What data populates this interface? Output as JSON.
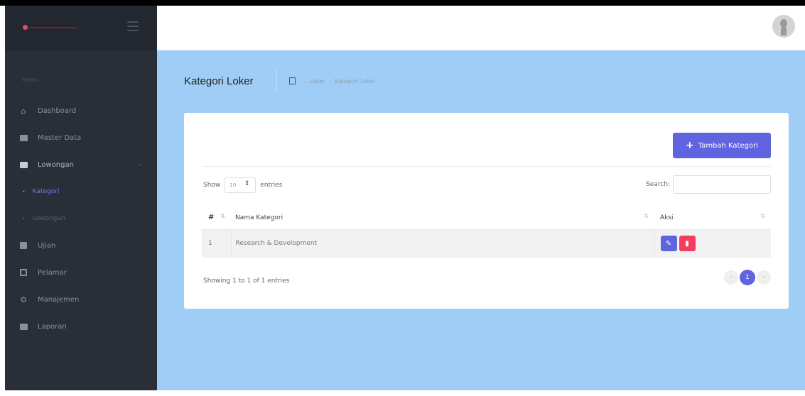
{
  "sidebar": {
    "menu_label": "MENU",
    "items": [
      {
        "label": "Dashboard",
        "icon": "dashboard-icon"
      },
      {
        "label": "Master Data",
        "icon": "folder-icon"
      },
      {
        "label": "Lowongan",
        "icon": "briefcase-icon"
      },
      {
        "label": "Ujian",
        "icon": "exam-icon"
      },
      {
        "label": "Pelamar",
        "icon": "applicant-icon"
      },
      {
        "label": "Manajemen",
        "icon": "gear-icon"
      },
      {
        "label": "Laporan",
        "icon": "folder-icon"
      }
    ],
    "subitems": [
      {
        "label": "Kategori"
      },
      {
        "label": "Lowongan"
      }
    ]
  },
  "page": {
    "title": "Kategori Loker",
    "breadcrumb": [
      "Loker",
      "Kategori Loker"
    ]
  },
  "toolbar": {
    "add_label": "Tambah Kategori"
  },
  "datatable": {
    "show_label": "Show",
    "length_value": "10",
    "entries_label": "entries",
    "search_label": "Search:",
    "search_value": "",
    "columns": [
      "#",
      "Nama Kategori",
      "Aksi"
    ],
    "rows": [
      {
        "no": "1",
        "name": "Research & Development"
      }
    ],
    "info": "Showing 1 to 1 of 1 entries",
    "page": "1"
  },
  "colors": {
    "sidebar_bg": "#2a2e36",
    "content_bg": "#9fcdf6",
    "primary": "#6064e0",
    "danger": "#f23d5e",
    "active_menu": "#6b7cff"
  }
}
